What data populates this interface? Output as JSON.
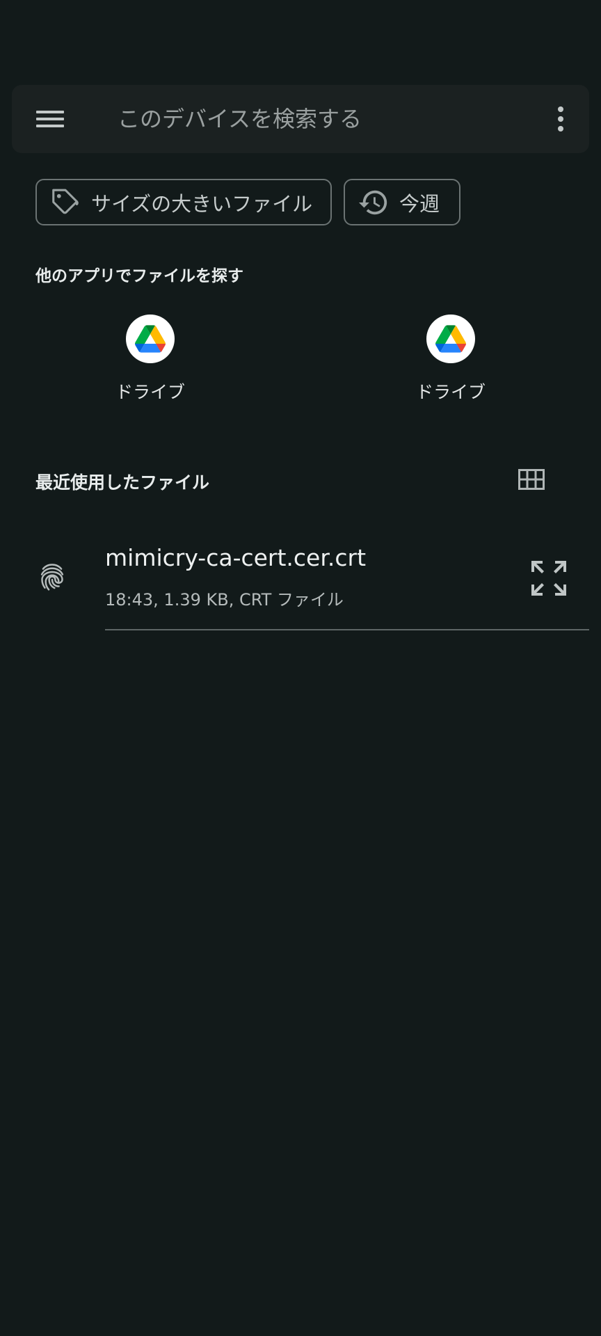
{
  "search": {
    "placeholder": "このデバイスを検索する",
    "menu_icon": "menu-icon",
    "more_icon": "more-vert-icon"
  },
  "chips": [
    {
      "label": "サイズの大きいファイル",
      "icon": "tag-icon"
    },
    {
      "label": "今週",
      "icon": "history-icon"
    }
  ],
  "other_apps": {
    "title": "他のアプリでファイルを探す",
    "apps": [
      {
        "label": "ドライブ",
        "icon": "google-drive-icon"
      },
      {
        "label": "ドライブ",
        "icon": "google-drive-icon"
      }
    ]
  },
  "recent": {
    "title": "最近使用したファイル",
    "view_toggle_icon": "grid-view-icon",
    "files": [
      {
        "name": "mimicry-ca-cert.cer.crt",
        "meta": "18:43, 1.39 KB, CRT ファイル",
        "icon": "fingerprint-icon",
        "action_icon": "expand-icon"
      }
    ]
  },
  "colors": {
    "background": "#121a1a",
    "search_bar": "#1b2121",
    "chip_border": "#6b7373",
    "text_primary": "#e3e6e6",
    "text_secondary": "#b5bbbb",
    "drive_green": "#1ea362",
    "drive_yellow": "#ffba00",
    "drive_blue": "#4285f4",
    "drive_dark_blue": "#3777e3"
  }
}
